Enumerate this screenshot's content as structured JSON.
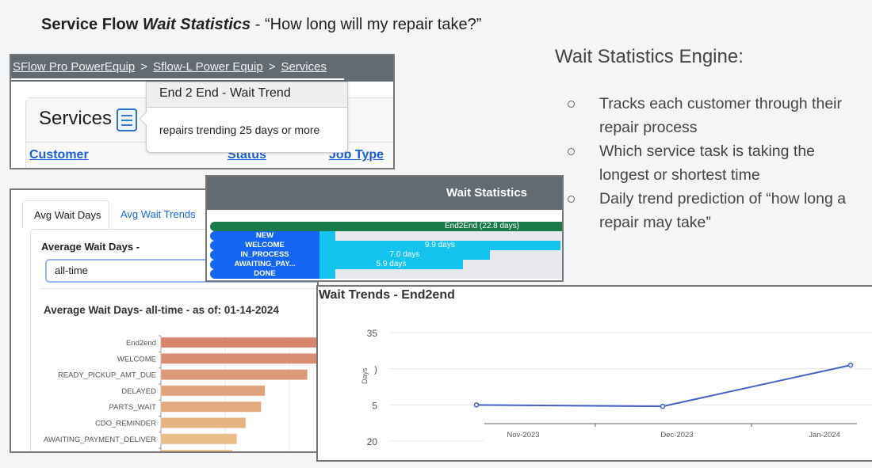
{
  "slide": {
    "title_bold": "Service Flow ",
    "title_italic": "Wait Statistics",
    "title_rest": " - “How long will my repair take?”"
  },
  "services_panel": {
    "breadcrumb": [
      "SFlow Pro PowerEquip",
      "Sflow-L Power Equip",
      "Services"
    ],
    "breadcrumb_sep": ">",
    "title": "Services",
    "menu_icon": "hamburger-menu-icon",
    "columns": [
      "Customer",
      "Status",
      "Job Type"
    ],
    "popover": {
      "title": "End 2 End - Wait Trend",
      "body": "repairs trending 25 days or more"
    }
  },
  "avg_panel": {
    "tabs": [
      {
        "label": "Avg Wait Days",
        "active": true
      },
      {
        "label": "Avg Wait Trends",
        "active": false
      }
    ],
    "filter_label": "Average Wait Days -",
    "filter_value": "all-time",
    "chart_title": "Average Wait Days- all-time - as of: 01-14-2024"
  },
  "wait_stats_panel": {
    "title": "Wait Statistics",
    "end2end_label": "End2End (22.8 days)",
    "rows": [
      {
        "label": "NEW",
        "days": 0.5,
        "value_label": ""
      },
      {
        "label": "WELCOME",
        "days": 9.9,
        "value_label": "9.9 days"
      },
      {
        "label": "IN_PROCESS",
        "days": 7.0,
        "value_label": "7.0 days"
      },
      {
        "label": "AWAITING_PAY...",
        "days": 5.9,
        "value_label": "5.9 days"
      },
      {
        "label": "DONE",
        "days": 0.5,
        "value_label": ""
      }
    ],
    "max_days": 10.1
  },
  "engine": {
    "title": "Wait Statistics Engine:",
    "bullets": [
      "Tracks each customer through their repair process",
      "Which service task is taking the longest or shortest time",
      "Daily trend prediction of “how long a repair may take”"
    ]
  },
  "trend_panel": {
    "title": "Wait Trends - End2end"
  },
  "colors": {
    "header_gray": "#626a72",
    "end2end_green": "#1a7a4a",
    "label_blue": "#1565f5",
    "bar_cyan": "#14c3ee",
    "link_blue": "#1a5fd6",
    "trend_line": "#4462c8"
  },
  "chart_data": [
    {
      "type": "bar",
      "orientation": "horizontal",
      "title": "Average Wait Days- all-time - as of: 01-14-2024",
      "categories": [
        "End2end",
        "WELCOME",
        "READY_PICKUP_AMT_DUE",
        "DELAYED",
        "PARTS_WAIT",
        "CDO_REMINDER",
        "AWAITING_PAYMENT_DELIVER"
      ],
      "values": [
        22.8,
        15.0,
        11.4,
        8.1,
        7.8,
        6.6,
        5.9
      ],
      "xlim": [
        0,
        15
      ],
      "grid_step": 5,
      "colors": [
        "#d6846c",
        "#d98e73",
        "#dc9877",
        "#e0a27b",
        "#e2aa7e",
        "#e6b483",
        "#e8bd88"
      ],
      "xlabel": "",
      "ylabel": ""
    },
    {
      "type": "line",
      "title": "Wait Trends - End2end",
      "x": [
        "Nov-2023",
        "Dec-2023",
        "Jan-2024"
      ],
      "series": [
        {
          "name": "End2end",
          "values": [
            25.0,
            24.8,
            30.5
          ]
        }
      ],
      "ylabel": "Days",
      "xlabel": "",
      "ylim": [
        20,
        35
      ],
      "yticks": [
        "20",
        "5",
        ")",
        "35"
      ],
      "grid": true
    }
  ]
}
